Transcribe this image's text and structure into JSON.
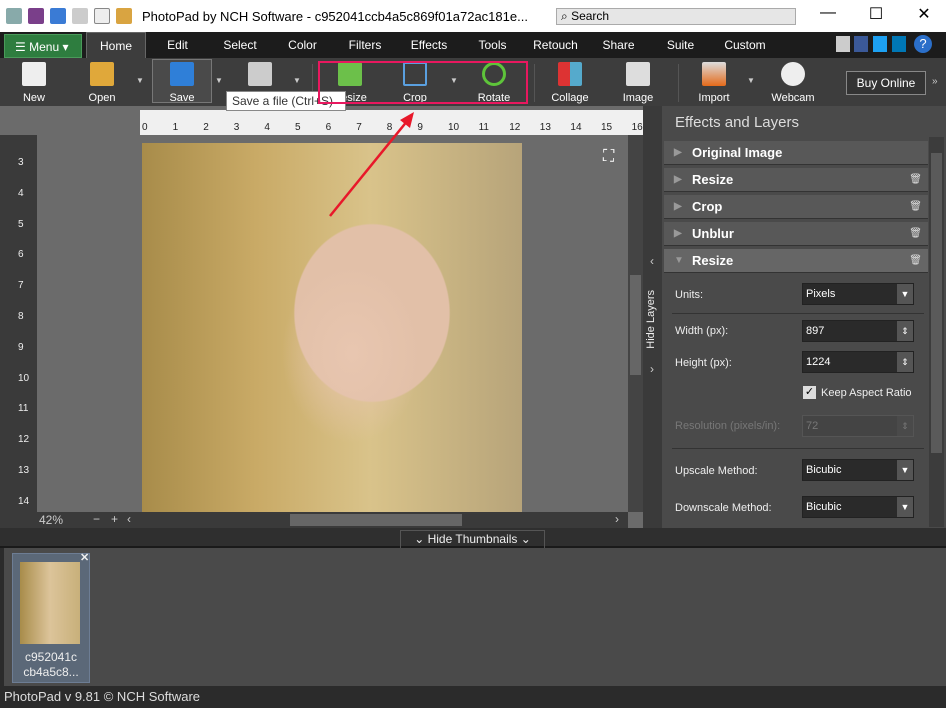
{
  "titlebar": {
    "title": "PhotoPad by NCH Software - c952041ccb4a5c869f01a72ac181e...",
    "search_placeholder": "Search",
    "minimize": "—",
    "maximize": "☐",
    "close": "✕"
  },
  "menu": {
    "label": "Menu"
  },
  "tabs": [
    "Home",
    "Edit",
    "Select",
    "Color",
    "Filters",
    "Effects",
    "Tools",
    "Retouch",
    "Share",
    "Suite",
    "Custom"
  ],
  "toolbar": {
    "new": "New",
    "open": "Open",
    "save": "Save",
    "print": "",
    "resize": "Resize",
    "crop": "Crop",
    "rotate": "Rotate",
    "collage": "Collage",
    "image": "Image",
    "import": "Import",
    "webcam": "Webcam",
    "buy": "Buy Online",
    "more": "»"
  },
  "tooltip": "Save a file (Ctrl+S)",
  "highlight_color": "#e8185f",
  "ruler_top": [
    "0",
    "1",
    "2",
    "3",
    "4",
    "5",
    "6",
    "7",
    "8",
    "9",
    "10",
    "11",
    "12",
    "13",
    "14",
    "15",
    "16"
  ],
  "ruler_left": [
    "3",
    "4",
    "5",
    "6",
    "7",
    "8",
    "9",
    "10",
    "11",
    "12",
    "13",
    "14"
  ],
  "zoom": "42%",
  "hide_layers": "Hide Layers",
  "panel": {
    "title": "Effects and Layers",
    "layers": [
      {
        "name": "Original Image",
        "trash": false
      },
      {
        "name": "Resize",
        "trash": true
      },
      {
        "name": "Crop",
        "trash": true
      },
      {
        "name": "Unblur",
        "trash": true
      },
      {
        "name": "Resize",
        "trash": true,
        "expanded": true
      }
    ],
    "units_label": "Units:",
    "units_value": "Pixels",
    "width_label": "Width (px):",
    "width_value": "897",
    "height_label": "Height (px):",
    "height_value": "1224",
    "keep_aspect": "Keep Aspect Ratio",
    "keep_aspect_checked": true,
    "resolution_label": "Resolution (pixels/in):",
    "resolution_value": "72",
    "upscale_label": "Upscale Method:",
    "upscale_value": "Bicubic",
    "downscale_label": "Downscale Method:",
    "downscale_value": "Bicubic"
  },
  "hide_thumbnails": "Hide Thumbnails",
  "thumbnail": {
    "line1": "c952041c",
    "line2": "cb4a5c8..."
  },
  "status": "PhotoPad v 9.81 © NCH Software"
}
